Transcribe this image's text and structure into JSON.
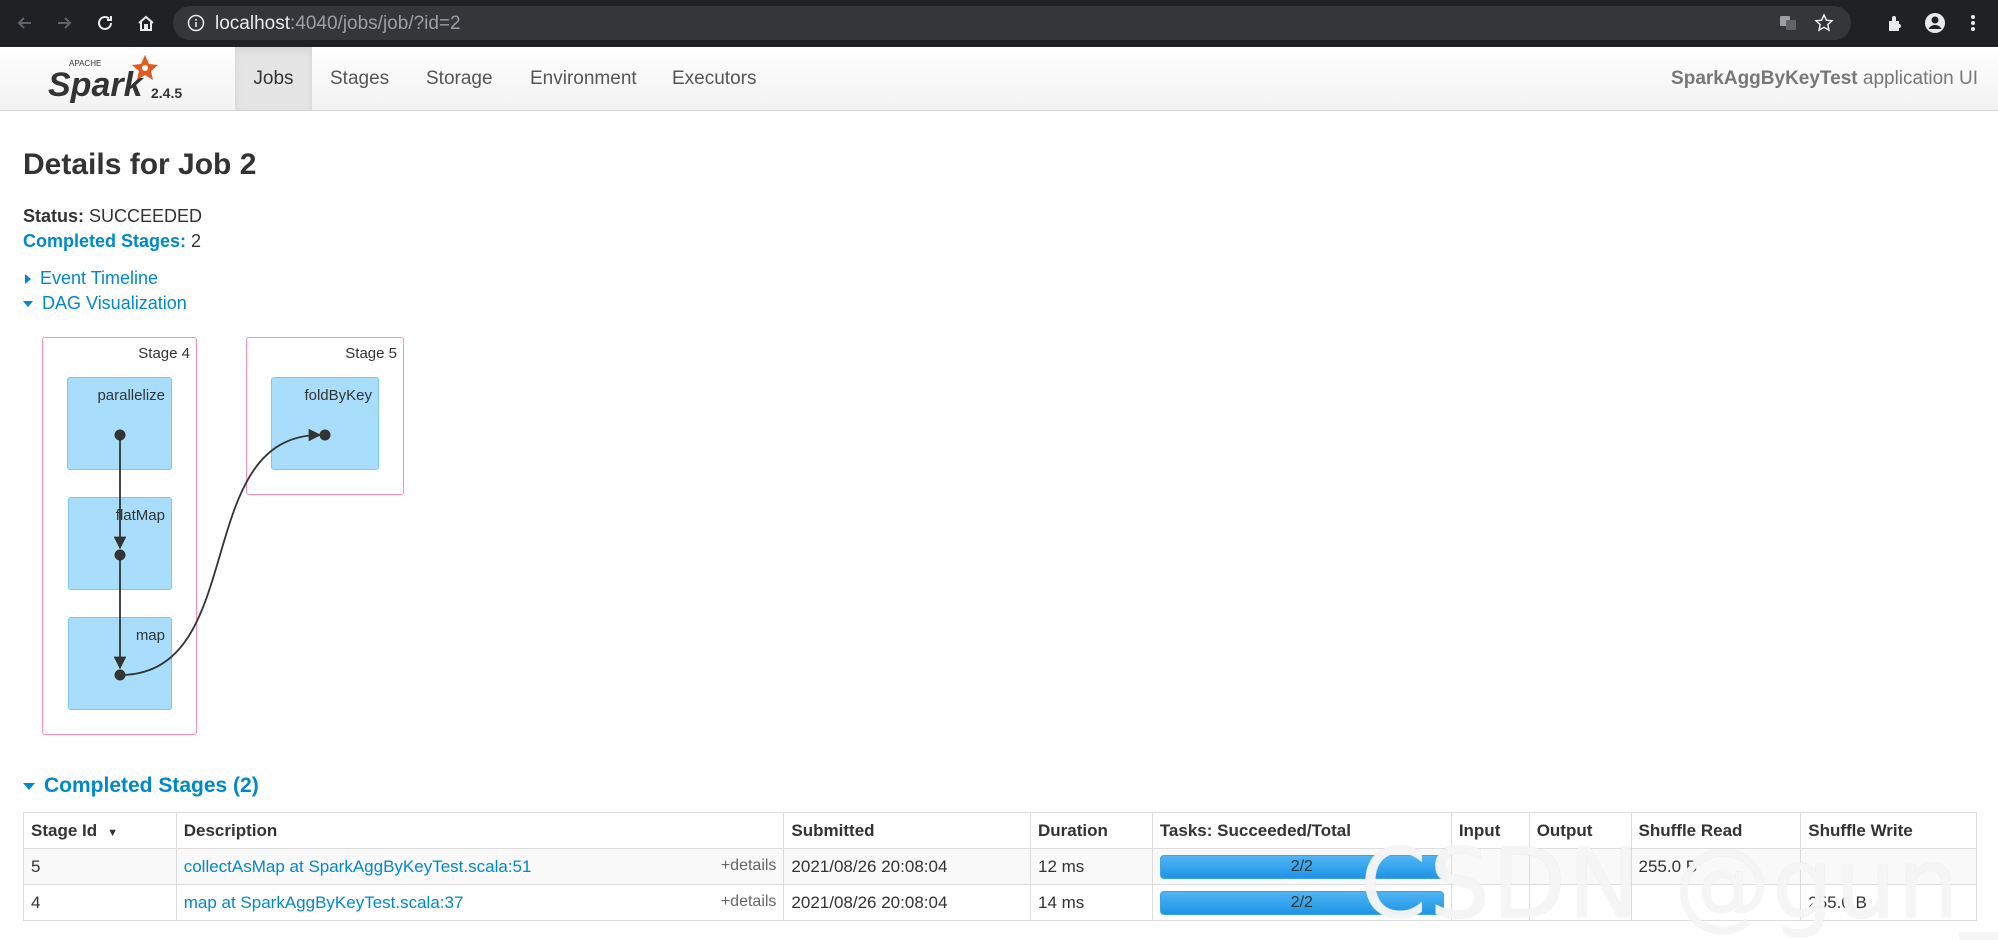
{
  "browser": {
    "url_host": "localhost",
    "url_path": ":4040/jobs/job/?id=2"
  },
  "navbar": {
    "logo_small_text": "APACHE",
    "logo_text": "Spark",
    "version": "2.4.5",
    "tabs": [
      {
        "label": "Jobs",
        "active": true
      },
      {
        "label": "Stages",
        "active": false
      },
      {
        "label": "Storage",
        "active": false
      },
      {
        "label": "Environment",
        "active": false
      },
      {
        "label": "Executors",
        "active": false
      }
    ],
    "app_name": "SparkAggByKeyTest",
    "app_suffix": " application UI"
  },
  "page": {
    "title": "Details for Job 2",
    "status_label": "Status:",
    "status_value": " SUCCEEDED",
    "completed_label": "Completed Stages:",
    "completed_value": " 2",
    "event_timeline": "Event Timeline",
    "dag_visualization": "DAG Visualization"
  },
  "dag": {
    "stages": [
      {
        "label": "Stage 4",
        "ops": [
          "parallelize",
          "flatMap",
          "map"
        ]
      },
      {
        "label": "Stage 5",
        "ops": [
          "foldByKey"
        ]
      }
    ]
  },
  "completed_stages": {
    "header": "Completed Stages (2)",
    "columns": [
      "Stage Id",
      "Description",
      "Submitted",
      "Duration",
      "Tasks: Succeeded/Total",
      "Input",
      "Output",
      "Shuffle Read",
      "Shuffle Write"
    ],
    "sort_indicator": "▼",
    "details_label": "+details",
    "rows": [
      {
        "stage_id": "5",
        "description": "collectAsMap at SparkAggByKeyTest.scala:51",
        "submitted": "2021/08/26 20:08:04",
        "duration": "12 ms",
        "tasks": "2/2",
        "tasks_fraction": 1.0,
        "input": "",
        "output": "",
        "shuffle_read": "255.0 B",
        "shuffle_write": ""
      },
      {
        "stage_id": "4",
        "description": "map at SparkAggByKeyTest.scala:37",
        "submitted": "2021/08/26 20:08:04",
        "duration": "14 ms",
        "tasks": "2/2",
        "tasks_fraction": 1.0,
        "input": "",
        "output": "",
        "shuffle_read": "",
        "shuffle_write": "255.0 B"
      }
    ]
  },
  "watermark": "CSDN @gun_K",
  "colors": {
    "accent": "#0088cc",
    "stage_border": "#ff8fb0",
    "op_fill": "#a8ddfb",
    "progress": "#1e95e6"
  }
}
